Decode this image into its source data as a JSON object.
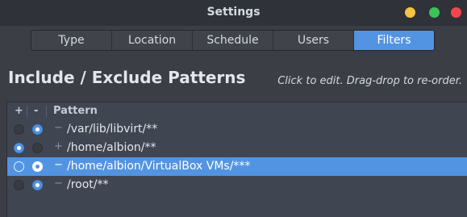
{
  "window": {
    "title": "Settings"
  },
  "tabs": [
    {
      "label": "Type"
    },
    {
      "label": "Location"
    },
    {
      "label": "Schedule"
    },
    {
      "label": "Users"
    },
    {
      "label": "Filters",
      "active": true
    }
  ],
  "section": {
    "title": "Include / Exclude Patterns",
    "hint": "Click to edit. Drag-drop to re-order."
  },
  "list": {
    "columns": {
      "include": "+",
      "exclude": "-",
      "pattern": "Pattern"
    },
    "rows": [
      {
        "include": false,
        "exclude": true,
        "sign": "−",
        "pattern": "/var/lib/libvirt/**",
        "selected": false
      },
      {
        "include": true,
        "exclude": false,
        "sign": "+",
        "pattern": "/home/albion/**",
        "selected": false
      },
      {
        "include": false,
        "exclude": true,
        "sign": "−",
        "pattern": "/home/albion/VirtualBox VMs/***",
        "selected": true
      },
      {
        "include": false,
        "exclude": true,
        "sign": "−",
        "pattern": "/root/**",
        "selected": false
      }
    ]
  },
  "colors": {
    "accent": "#5294e2",
    "window_bg": "#3b3e45",
    "titlebar_bg": "#2f3238",
    "list_bg": "#404552",
    "minimize": "#f6c343",
    "maximize": "#3bc35a",
    "close": "#f2464b"
  }
}
